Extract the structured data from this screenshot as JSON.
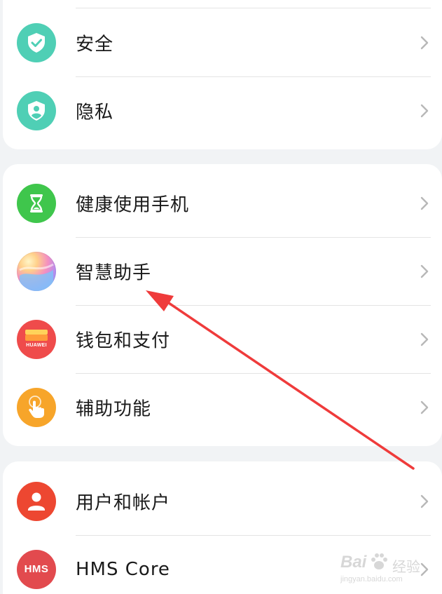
{
  "colors": {
    "background": "#f1f3f5",
    "card": "#ffffff",
    "text": "#1a1a1a",
    "chevron": "#b8b8b8",
    "divider": "#e4e4e4",
    "security_icon": "#4fcfb5",
    "privacy_icon": "#4fcfb5",
    "health_icon": "#3fc64c",
    "wallet_icon": "#ef4b4b",
    "accessibility_icon": "#f7a52a",
    "users_icon": "#ed4731",
    "hms_icon": "#e24a4e",
    "annotation_arrow": "#ef3b3b"
  },
  "groups": [
    {
      "items": [
        {
          "label": "安全",
          "icon": "shield-check-icon"
        },
        {
          "label": "隐私",
          "icon": "shield-person-icon"
        }
      ]
    },
    {
      "items": [
        {
          "label": "健康使用手机",
          "icon": "hourglass-icon"
        },
        {
          "label": "智慧助手",
          "icon": "celia-orb-icon"
        },
        {
          "label": "钱包和支付",
          "icon": "huawei-wallet-icon",
          "icon_text": "HUAWEI"
        },
        {
          "label": "辅助功能",
          "icon": "hand-pointer-icon"
        }
      ]
    },
    {
      "items": [
        {
          "label": "用户和帐户",
          "icon": "user-icon"
        },
        {
          "label": "HMS Core",
          "icon": "hms-icon",
          "icon_text": "HMS"
        }
      ]
    }
  ],
  "watermark": {
    "brand": "Bai",
    "brand_cn": "经验",
    "url": "jingyan.baidu.com"
  }
}
